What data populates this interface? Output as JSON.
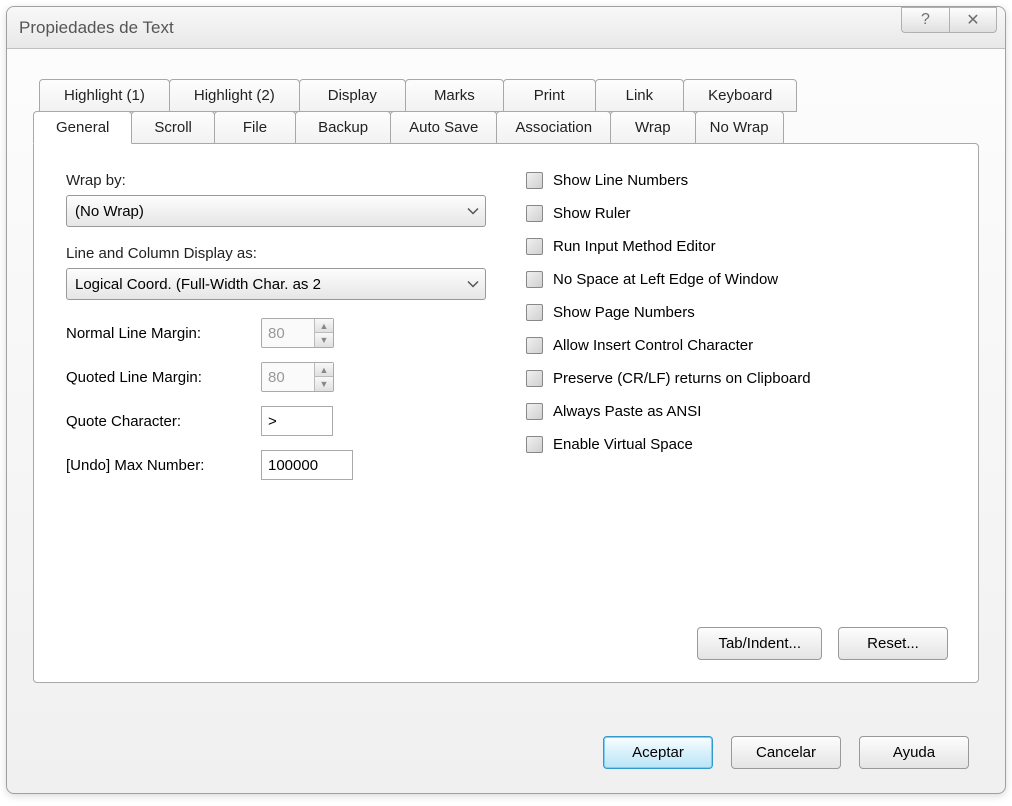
{
  "title": "Propiedades de Text",
  "titlebar_buttons": {
    "help": "?",
    "close": "✕"
  },
  "tabs_row1": [
    {
      "label": "Highlight (1)"
    },
    {
      "label": "Highlight (2)"
    },
    {
      "label": "Display"
    },
    {
      "label": "Marks"
    },
    {
      "label": "Print"
    },
    {
      "label": "Link"
    },
    {
      "label": "Keyboard"
    }
  ],
  "tabs_row2": [
    {
      "label": "General",
      "active": true
    },
    {
      "label": "Scroll"
    },
    {
      "label": "File"
    },
    {
      "label": "Backup"
    },
    {
      "label": "Auto Save"
    },
    {
      "label": "Association"
    },
    {
      "label": "Wrap"
    },
    {
      "label": "No Wrap"
    }
  ],
  "left": {
    "wrap_by_label": "Wrap by:",
    "wrap_by_value": "(No Wrap)",
    "display_as_label": "Line and Column Display as:",
    "display_as_value": "Logical Coord. (Full-Width Char. as 2",
    "normal_margin_label": "Normal Line Margin:",
    "normal_margin_value": "80",
    "quoted_margin_label": "Quoted Line Margin:",
    "quoted_margin_value": "80",
    "quote_char_label": "Quote Character:",
    "quote_char_value": ">",
    "undo_label": "[Undo] Max Number:",
    "undo_value": "100000"
  },
  "right_checks": [
    "Show Line Numbers",
    "Show Ruler",
    "Run Input Method Editor",
    "No Space at Left Edge of Window",
    "Show Page Numbers",
    "Allow Insert Control Character",
    "Preserve (CR/LF) returns on Clipboard",
    "Always Paste as ANSI",
    "Enable Virtual Space"
  ],
  "inner_buttons": {
    "tab_indent": "Tab/Indent...",
    "reset": "Reset..."
  },
  "dialog_buttons": {
    "accept": "Aceptar",
    "cancel": "Cancelar",
    "help": "Ayuda"
  }
}
